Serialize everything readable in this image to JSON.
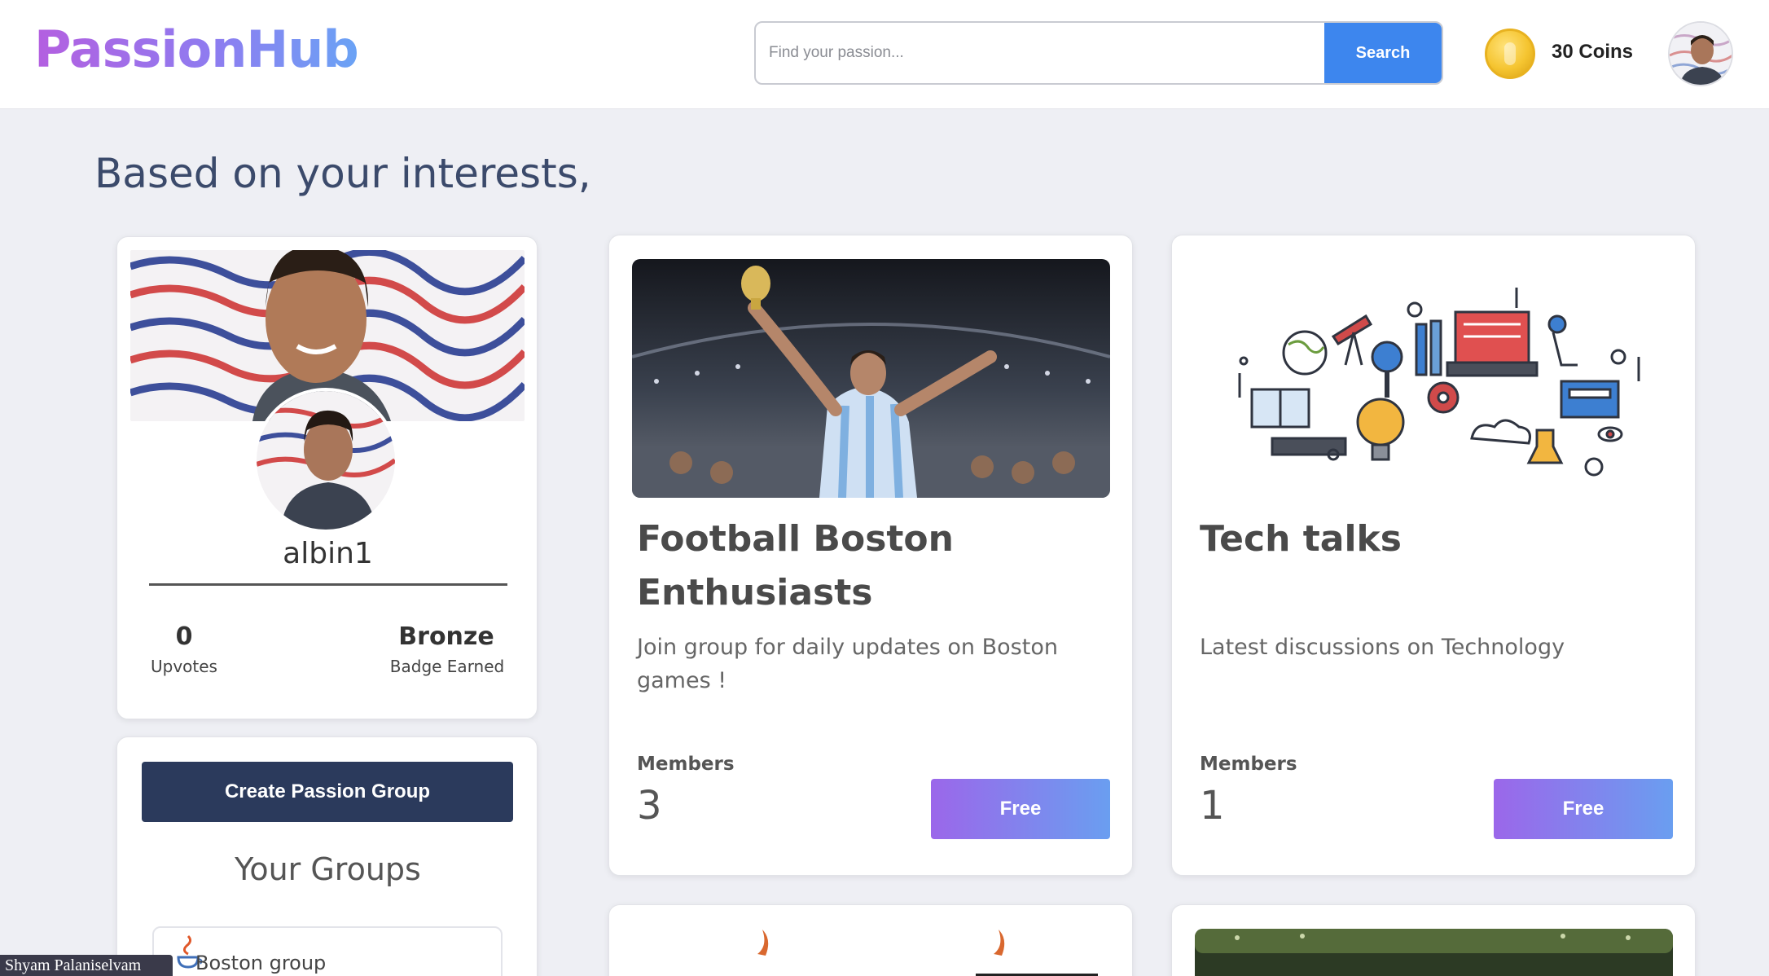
{
  "header": {
    "logo": "PassionHub",
    "search_placeholder": "Find your passion...",
    "search_button": "Search",
    "coins_label": "30 Coins",
    "coin_icon": "gold-coin-icon",
    "avatar_icon": "user-avatar"
  },
  "main": {
    "section_title": "Based on your interests,"
  },
  "profile": {
    "username": "albin1",
    "upvotes_value": "0",
    "upvotes_label": "Upvotes",
    "badge_value": "Bronze",
    "badge_label": "Badge Earned"
  },
  "groups_panel": {
    "create_button": "Create Passion Group",
    "title": "Your Groups",
    "items": [
      {
        "name": "Boston group",
        "icon": "java-cup-icon"
      }
    ]
  },
  "cards": [
    {
      "title": "Football Boston Enthusiasts",
      "description": "Join group for daily updates on Boston games !",
      "members_label": "Members",
      "members_count": "3",
      "button": "Free",
      "image": "football-celebration-image"
    },
    {
      "title": "Tech talks",
      "description": "Latest discussions on Technology",
      "members_label": "Members",
      "members_count": "1",
      "button": "Free",
      "image": "technology-doodle-image"
    }
  ],
  "presenter": {
    "name": "Shyam Palaniselvam"
  },
  "colors": {
    "accent_blue": "#3d86ee",
    "navy": "#2b3a5c",
    "gradient_start": "#9b67ea",
    "gradient_end": "#6a9ef0",
    "background": "#eeeff4"
  }
}
